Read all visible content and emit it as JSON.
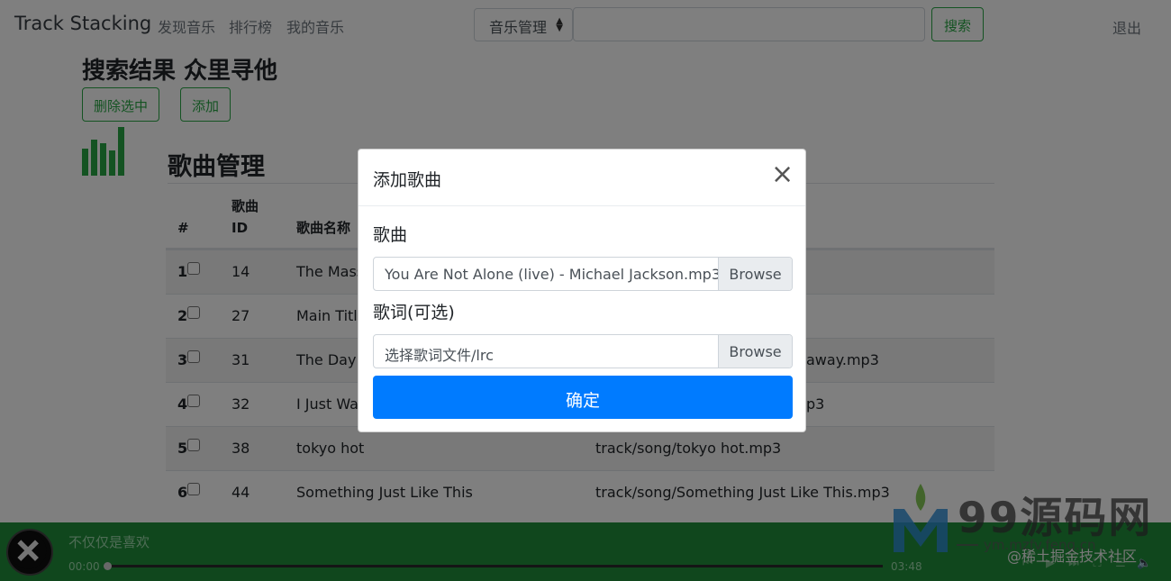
{
  "navbar": {
    "brand": "Track Stacking",
    "links": [
      "发现音乐",
      "排行榜",
      "我的音乐"
    ],
    "select_value": "音乐管理",
    "search_value": "",
    "search_label": "搜索",
    "logout_label": "退出"
  },
  "page": {
    "results_title": "搜索结果 众里寻他",
    "delete_selected_label": "删除选中",
    "add_label": "添加",
    "section_title": "歌曲管理"
  },
  "table": {
    "headers": {
      "index": "#",
      "song_id_line1": "歌曲",
      "song_id_line2": "ID",
      "song_name": "歌曲名称"
    },
    "rows": [
      {
        "index": "1",
        "id": "14",
        "name": "The Mass",
        "path": ""
      },
      {
        "index": "2",
        "id": "27",
        "name": "Main Title",
        "path": ""
      },
      {
        "index": "3",
        "id": "31",
        "name": "The Day Y",
        "path": "away.mp3"
      },
      {
        "index": "4",
        "id": "32",
        "name": "I Just Wa",
        "path": "p3"
      },
      {
        "index": "5",
        "id": "38",
        "name": "tokyo hot",
        "path": "track/song/tokyo hot.mp3"
      },
      {
        "index": "6",
        "id": "44",
        "name": "Something Just Like This",
        "path": "track/song/Something Just Like This.mp3"
      }
    ]
  },
  "modal": {
    "title": "添加歌曲",
    "close_symbol": "×",
    "song_label": "歌曲",
    "song_file": "You Are Not Alone (live) - Michael Jackson.mp3",
    "lyrics_label": "歌词(可选)",
    "lyrics_file": "选择歌词文件/lrc",
    "browse_label": "Browse",
    "confirm_label": "确定"
  },
  "player": {
    "title": "不仅仅是喜欢",
    "current_time": "00:00",
    "duration": "03:48",
    "progress_fraction": 0
  },
  "watermark": {
    "text": "99源码网",
    "sub": "ym.mzfv.feng.cn",
    "credit": "@稀土掘金技术社区"
  },
  "colors": {
    "primary": "#007bff",
    "success": "#28a745",
    "player_bg": "#208f3a"
  }
}
